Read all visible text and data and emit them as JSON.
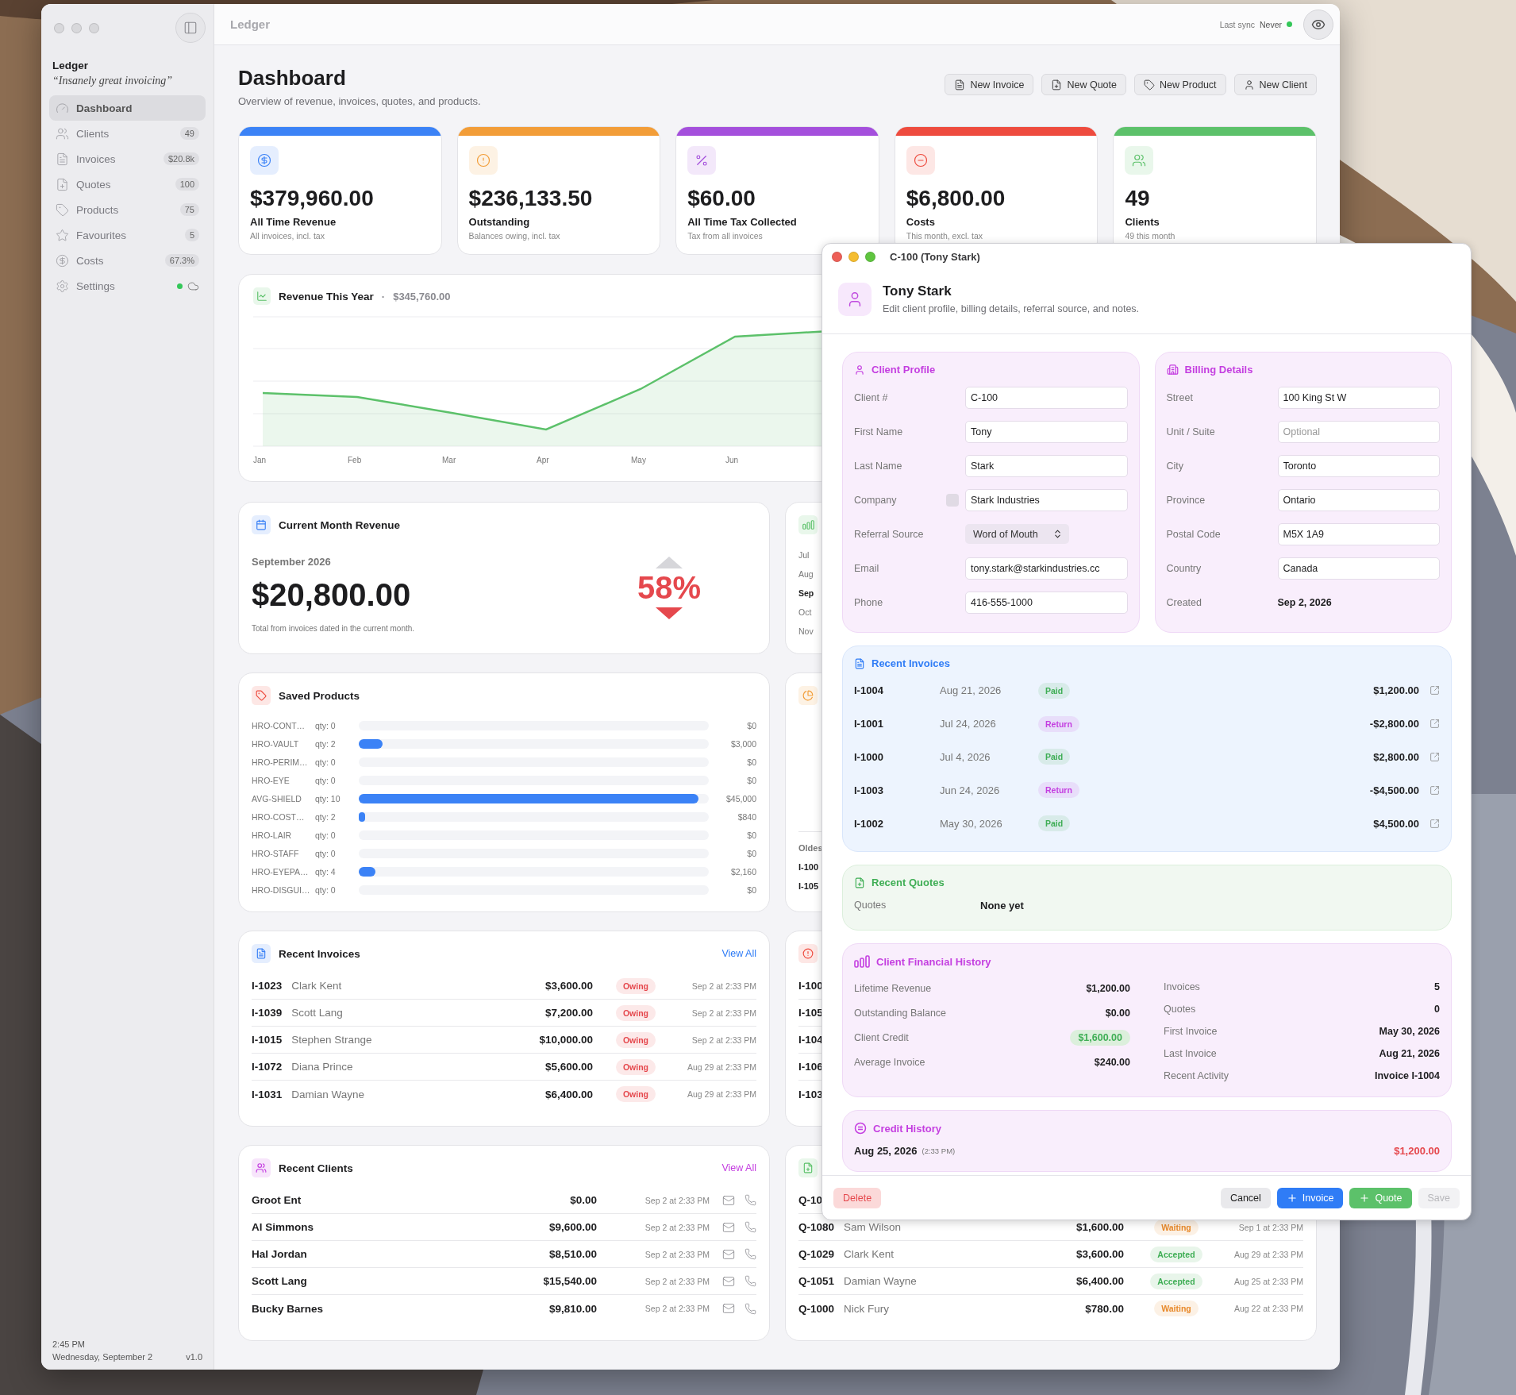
{
  "sidebar": {
    "app_name": "Ledger",
    "tagline": "“Insanely great invoicing”",
    "items": [
      {
        "label": "Dashboard",
        "selected": true
      },
      {
        "label": "Clients",
        "badge": "49",
        "selected": false
      },
      {
        "label": "Invoices",
        "badge": "$20.8k",
        "selected": false
      },
      {
        "label": "Quotes",
        "badge": "100",
        "selected": false
      },
      {
        "label": "Products",
        "badge": "75",
        "selected": false
      },
      {
        "label": "Favourites",
        "badge": "5",
        "selected": false
      },
      {
        "label": "Costs",
        "badge": "67.3%",
        "selected": false
      },
      {
        "label": "Settings",
        "synced": true,
        "selected": false
      }
    ],
    "time": "2:45 PM",
    "date": "Wednesday, September 2",
    "version": "v1.0"
  },
  "toolbar": {
    "title": "Ledger",
    "sync_label": "Last sync",
    "sync_value": "Never",
    "synced": true
  },
  "header": {
    "title": "Dashboard",
    "subtitle": "Overview of revenue, invoices, quotes, and products.",
    "actions": [
      "New Invoice",
      "New Quote",
      "New Product",
      "New Client"
    ]
  },
  "stats": [
    {
      "value": "$379,960.00",
      "label": "All Time Revenue",
      "note": "All invoices, incl. tax",
      "color": "#3b82f6"
    },
    {
      "value": "$236,133.50",
      "label": "Outstanding",
      "note": "Balances owing, incl. tax",
      "color": "#f29d38"
    },
    {
      "value": "$60.00",
      "label": "All Time Tax Collected",
      "note": "Tax from all invoices",
      "color": "#a44fdc"
    },
    {
      "value": "$6,800.00",
      "label": "Costs",
      "note": "This month, excl. tax",
      "color": "#ee4b3e"
    },
    {
      "value": "49",
      "label": "Clients",
      "note": "49 this month",
      "color": "#5cc16a"
    }
  ],
  "revenue_chart": {
    "title": "Revenue This Year",
    "separator": "·",
    "total": "$345,760.00",
    "months": [
      "Jan",
      "Feb",
      "Mar",
      "Apr",
      "May",
      "Jun"
    ]
  },
  "current_month": {
    "title": "Current Month Revenue",
    "month": "September 2026",
    "amount": "$20,800.00",
    "change": "58%",
    "decrease": true,
    "note": "Total from invoices dated in the current month."
  },
  "saved_products": {
    "title": "Saved Products",
    "items": [
      {
        "code": "HRO-CONT…",
        "qty": "qty: 0",
        "value": "$0"
      },
      {
        "code": "HRO-VAULT",
        "qty": "qty: 2",
        "value": "$3,000",
        "level": 0.067
      },
      {
        "code": "HRO-PERIM…",
        "qty": "qty: 0",
        "value": "$0"
      },
      {
        "code": "HRO-EYE",
        "qty": "qty: 0",
        "value": "$0"
      },
      {
        "code": "AVG-SHIELD",
        "qty": "qty: 10",
        "value": "$45,000",
        "level": 0.97
      },
      {
        "code": "HRO-COST…",
        "qty": "qty: 2",
        "value": "$840",
        "level": 0.019
      },
      {
        "code": "HRO-LAIR",
        "qty": "qty: 0",
        "value": "$0"
      },
      {
        "code": "HRO-STAFF",
        "qty": "qty: 0",
        "value": "$0"
      },
      {
        "code": "HRO-EYEPA…",
        "qty": "qty: 4",
        "value": "$2,160",
        "level": 0.048
      },
      {
        "code": "HRO-DISGUI…",
        "qty": "qty: 0",
        "value": "$0"
      }
    ]
  },
  "recent_invoices": {
    "title": "Recent Invoices",
    "link": "View All",
    "rows": [
      {
        "number": "I-1023",
        "client": "Clark Kent",
        "amount": "$3,600.00",
        "status": {
          "text": "Owing",
          "color": "#e5484d"
        },
        "date": "Sep 2 at 2:33 PM"
      },
      {
        "number": "I-1039",
        "client": "Scott Lang",
        "amount": "$7,200.00",
        "status": {
          "text": "Owing",
          "color": "#e5484d"
        },
        "date": "Sep 2 at 2:33 PM"
      },
      {
        "number": "I-1015",
        "client": "Stephen Strange",
        "amount": "$10,000.00",
        "status": {
          "text": "Owing",
          "color": "#e5484d"
        },
        "date": "Sep 2 at 2:33 PM"
      },
      {
        "number": "I-1072",
        "client": "Diana Prince",
        "amount": "$5,600.00",
        "status": {
          "text": "Owing",
          "color": "#e5484d"
        },
        "date": "Aug 29 at 2:33 PM"
      },
      {
        "number": "I-1031",
        "client": "Damian Wayne",
        "amount": "$6,400.00",
        "status": {
          "text": "Owing",
          "color": "#e5484d"
        },
        "date": "Aug 29 at 2:33 PM"
      }
    ]
  },
  "recent_clients": {
    "title": "Recent Clients",
    "link": "View All",
    "rows": [
      {
        "name": "Groot Ent",
        "amount": "$0.00",
        "date": "Sep 2 at 2:33 PM"
      },
      {
        "name": "Al Simmons",
        "amount": "$9,600.00",
        "date": "Sep 2 at 2:33 PM"
      },
      {
        "name": "Hal Jordan",
        "amount": "$8,510.00",
        "date": "Sep 2 at 2:33 PM"
      },
      {
        "name": "Scott Lang",
        "amount": "$15,540.00",
        "date": "Sep 2 at 2:33 PM"
      },
      {
        "name": "Bucky Barnes",
        "amount": "$9,810.00",
        "date": "Sep 2 at 2:33 PM"
      }
    ]
  },
  "monthly_card": {
    "months": [
      {
        "label": "Jul",
        "selected": false
      },
      {
        "label": "Aug",
        "selected": false
      },
      {
        "label": "Sep",
        "selected": true
      },
      {
        "label": "Oct",
        "selected": false
      },
      {
        "label": "Nov",
        "selected": false
      }
    ]
  },
  "aging_card": {
    "label": "Oldes",
    "rows": [
      "I-100",
      "I-105"
    ]
  },
  "overdue_card": {
    "rows": [
      "I-100",
      "I-105",
      "I-104",
      "I-106",
      "I-103"
    ]
  },
  "quotes_card": {
    "rows": [
      {
        "number": "Q-10"
      },
      {
        "number": "Q-1080",
        "client": "Sam Wilson",
        "amount": "$1,600.00",
        "status": {
          "text": "Waiting",
          "color": "#e8892a"
        },
        "date": "Sep 1 at 2:33 PM"
      },
      {
        "number": "Q-1029",
        "client": "Clark Kent",
        "amount": "$3,600.00",
        "status": {
          "text": "Accepted",
          "color": "#3fae55"
        },
        "date": "Aug 29 at 2:33 PM"
      },
      {
        "number": "Q-1051",
        "client": "Damian Wayne",
        "amount": "$6,400.00",
        "status": {
          "text": "Accepted",
          "color": "#3fae55"
        },
        "date": "Aug 25 at 2:33 PM"
      },
      {
        "number": "Q-1000",
        "client": "Nick Fury",
        "amount": "$780.00",
        "status": {
          "text": "Waiting",
          "color": "#e8892a"
        },
        "date": "Aug 22 at 2:33 PM"
      }
    ]
  },
  "client_window": {
    "title": "C-100 (Tony Stark)",
    "name": "Tony Stark",
    "subtitle": "Edit client profile, billing details, referral source, and notes.",
    "profile": {
      "title": "Client Profile",
      "fields": [
        {
          "label": "Client #",
          "kind": "input",
          "value": "C-100"
        },
        {
          "label": "First Name",
          "kind": "input",
          "value": "Tony"
        },
        {
          "label": "Last Name",
          "kind": "input",
          "value": "Stark"
        },
        {
          "label": "Company",
          "kind": "input",
          "value": "Stark Industries",
          "checked": false
        },
        {
          "label": "Referral Source",
          "kind": "select",
          "value": "Word of Mouth"
        },
        {
          "label": "Email",
          "kind": "input",
          "value": "tony.stark@starkindustries.cc"
        },
        {
          "label": "Phone",
          "kind": "input",
          "value": "416-555-1000"
        }
      ]
    },
    "billing": {
      "title": "Billing Details",
      "fields": [
        {
          "label": "Street",
          "kind": "input",
          "value": "100 King St W"
        },
        {
          "label": "Unit / Suite",
          "kind": "input",
          "placeholder": "Optional"
        },
        {
          "label": "City",
          "kind": "input",
          "value": "Toronto"
        },
        {
          "label": "Province",
          "kind": "input",
          "value": "Ontario"
        },
        {
          "label": "Postal Code",
          "kind": "input",
          "value": "M5X 1A9"
        },
        {
          "label": "Country",
          "kind": "input",
          "value": "Canada"
        },
        {
          "label": "Created",
          "kind": "text",
          "value": "Sep 2, 2026"
        }
      ]
    },
    "invoices": {
      "title": "Recent Invoices",
      "rows": [
        {
          "number": "I-1004",
          "date": "Aug 21, 2026",
          "status": {
            "text": "Paid",
            "color": "#3fae55"
          },
          "amount": "$1,200.00"
        },
        {
          "number": "I-1001",
          "date": "Jul 24, 2026",
          "status": {
            "text": "Return",
            "color": "#c43ee0"
          },
          "amount": "-$2,800.00"
        },
        {
          "number": "I-1000",
          "date": "Jul 4, 2026",
          "status": {
            "text": "Paid",
            "color": "#3fae55"
          },
          "amount": "$2,800.00"
        },
        {
          "number": "I-1003",
          "date": "Jun 24, 2026",
          "status": {
            "text": "Return",
            "color": "#c43ee0"
          },
          "amount": "-$4,500.00"
        },
        {
          "number": "I-1002",
          "date": "May 30, 2026",
          "status": {
            "text": "Paid",
            "color": "#3fae55"
          },
          "amount": "$4,500.00"
        }
      ]
    },
    "quotes": {
      "title": "Recent Quotes",
      "label": "Quotes",
      "value": "None yet"
    },
    "financial": {
      "title": "Client Financial History",
      "left": [
        {
          "label": "Lifetime Revenue",
          "value": "$1,200.00",
          "kind": "text"
        },
        {
          "label": "Outstanding Balance",
          "value": "$0.00",
          "kind": "text"
        },
        {
          "label": "Client Credit",
          "value": "$1,600.00",
          "kind": "pill"
        },
        {
          "label": "Average Invoice",
          "value": "$240.00",
          "kind": "text"
        }
      ],
      "right": [
        {
          "label": "Invoices",
          "value": "5",
          "kind": "text"
        },
        {
          "label": "Quotes",
          "value": "0",
          "kind": "text"
        },
        {
          "label": "First Invoice",
          "value": "May 30, 2026",
          "kind": "text"
        },
        {
          "label": "Last Invoice",
          "value": "Aug 21, 2026",
          "kind": "text"
        },
        {
          "label": "Recent Activity",
          "value": "Invoice I-1004",
          "kind": "text"
        }
      ]
    },
    "credit": {
      "title": "Credit History",
      "rows": [
        {
          "date": "Aug 25, 2026",
          "time": "(2:33 PM)",
          "amount": "$1,200.00"
        }
      ]
    },
    "buttons": [
      {
        "label": "Delete",
        "kind": "danger",
        "disabled": false
      },
      {
        "label": "Cancel",
        "kind": "plain",
        "disabled": false
      },
      {
        "label": "Invoice",
        "kind": "primary",
        "disabled": false
      },
      {
        "label": "Quote",
        "kind": "success",
        "disabled": false
      },
      {
        "label": "Save",
        "kind": "plain",
        "disabled": true
      }
    ]
  }
}
